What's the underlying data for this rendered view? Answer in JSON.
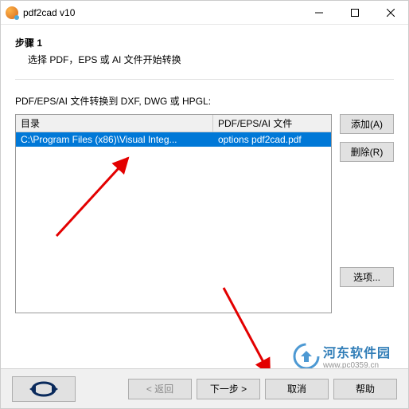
{
  "window": {
    "title": "pdf2cad v10"
  },
  "step": {
    "title": "步骤 1",
    "description": "选择 PDF，EPS 或 AI 文件开始转换"
  },
  "format_label": "PDF/EPS/AI 文件转换到 DXF, DWG 或 HPGL:",
  "table": {
    "headers": {
      "directory": "目录",
      "file": "PDF/EPS/AI 文件"
    },
    "rows": [
      {
        "directory": "C:\\Program Files (x86)\\Visual Integ...",
        "file": "options pdf2cad.pdf"
      }
    ]
  },
  "buttons": {
    "add": "添加(A)",
    "remove": "删除(R)",
    "options": "选项...",
    "back": "< 返回",
    "next": "下一步 >",
    "cancel": "取消",
    "help": "帮助"
  },
  "watermark": {
    "text": "河东软件园",
    "url": "www.pc0359.cn"
  }
}
